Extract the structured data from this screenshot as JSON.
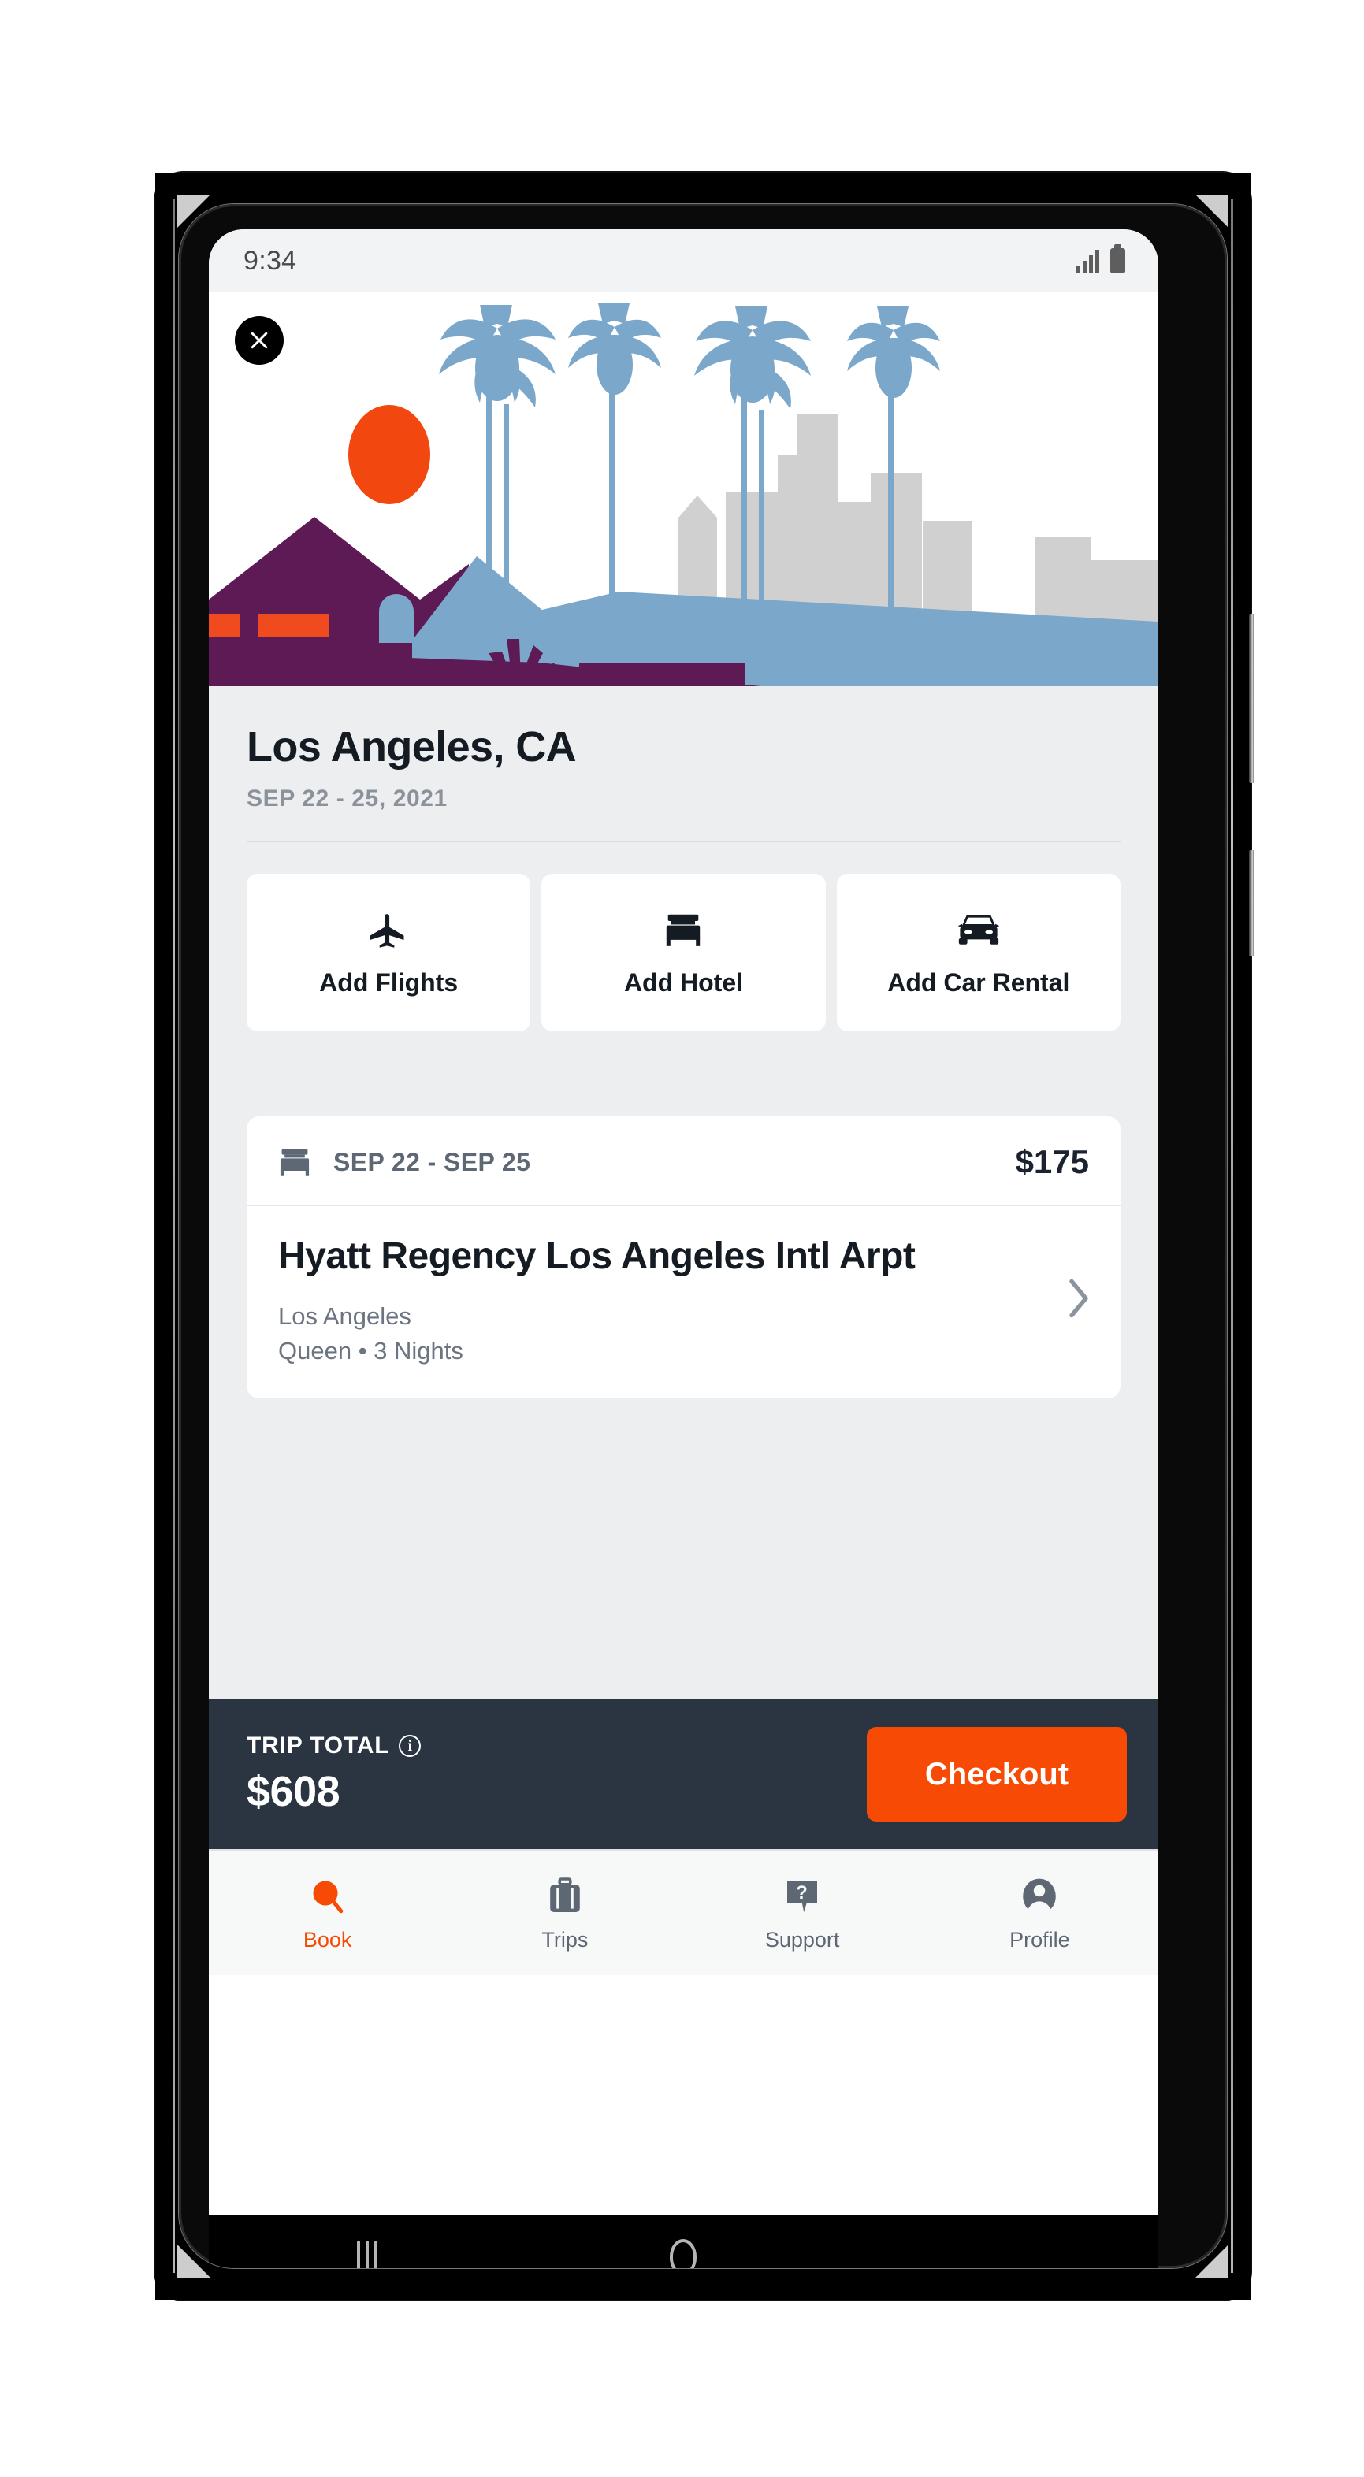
{
  "status_bar": {
    "time": "9:34",
    "signal_icon": "signal-bars-icon",
    "battery_icon": "battery-icon"
  },
  "hero": {
    "close_icon": "close-icon",
    "illustration": "los-angeles-skyline-illustration",
    "colors": {
      "sun": "#F2470F",
      "house": "#5E1A55",
      "window": "#F04B1E",
      "hill": "#7BA7CB",
      "building": "#D0D0D0",
      "palm": "#7BA7CB"
    }
  },
  "trip": {
    "title": "Los Angeles, CA",
    "dates": "SEP 22 - 25, 2021"
  },
  "actions": [
    {
      "label": "Add Flights",
      "icon": "airplane-icon"
    },
    {
      "label": "Add Hotel",
      "icon": "bed-icon"
    },
    {
      "label": "Add Car Rental",
      "icon": "car-icon"
    }
  ],
  "hotel": {
    "icon": "bed-icon",
    "date_range": "SEP 22 - SEP 25",
    "price": "$175",
    "name": "Hyatt Regency Los Angeles Intl Arpt",
    "city": "Los Angeles",
    "room_details": "Queen • 3 Nights",
    "chevron_icon": "chevron-right-icon"
  },
  "trip_total": {
    "label": "TRIP TOTAL",
    "info_icon": "info-icon",
    "info_glyph": "i",
    "amount": "$608",
    "checkout_label": "Checkout",
    "accent_color": "#F74A05",
    "bar_color": "#2B3541"
  },
  "tabs": [
    {
      "label": "Book",
      "icon": "search-icon",
      "active": true
    },
    {
      "label": "Trips",
      "icon": "suitcase-icon",
      "active": false
    },
    {
      "label": "Support",
      "icon": "question-bubble-icon",
      "active": false
    },
    {
      "label": "Profile",
      "icon": "person-circle-icon",
      "active": false
    }
  ],
  "android_nav": {
    "recents_icon": "recents-icon",
    "home_icon": "home-icon",
    "back_icon": "back-icon"
  }
}
